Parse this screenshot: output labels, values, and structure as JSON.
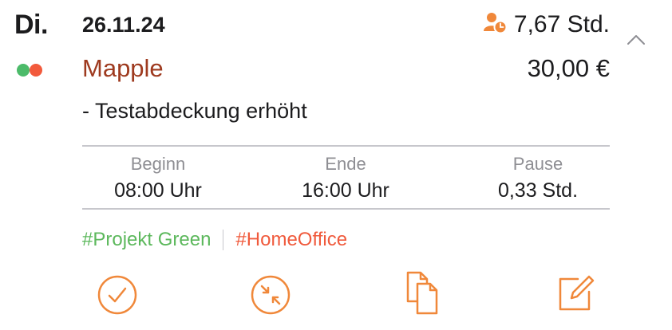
{
  "entry": {
    "weekday": "Di.",
    "date": "26.11.24",
    "duration": "7,67 Std.",
    "client": "Mapple",
    "amount": "30,00 €",
    "note": "- Testabdeckung erhöht"
  },
  "times": {
    "begin_label": "Beginn",
    "begin_value": "08:00 Uhr",
    "end_label": "Ende",
    "end_value": "16:00 Uhr",
    "pause_label": "Pause",
    "pause_value": "0,33 Std."
  },
  "tags": [
    {
      "label": "#Projekt Green",
      "color": "#5cb85c"
    },
    {
      "label": "#HomeOffice",
      "color": "#f05a3c"
    }
  ],
  "colors": {
    "accent": "#f0883a",
    "client": "#9e3a1f",
    "dot_green": "#4cbb6a",
    "dot_red": "#f25a3c"
  },
  "icons": {
    "duration": "person-clock-icon",
    "collapse": "chevron-up-icon",
    "complete": "checkmark-circle-icon",
    "merge": "arrows-inward-circle-icon",
    "duplicate": "duplicate-documents-icon",
    "edit": "edit-square-icon"
  }
}
